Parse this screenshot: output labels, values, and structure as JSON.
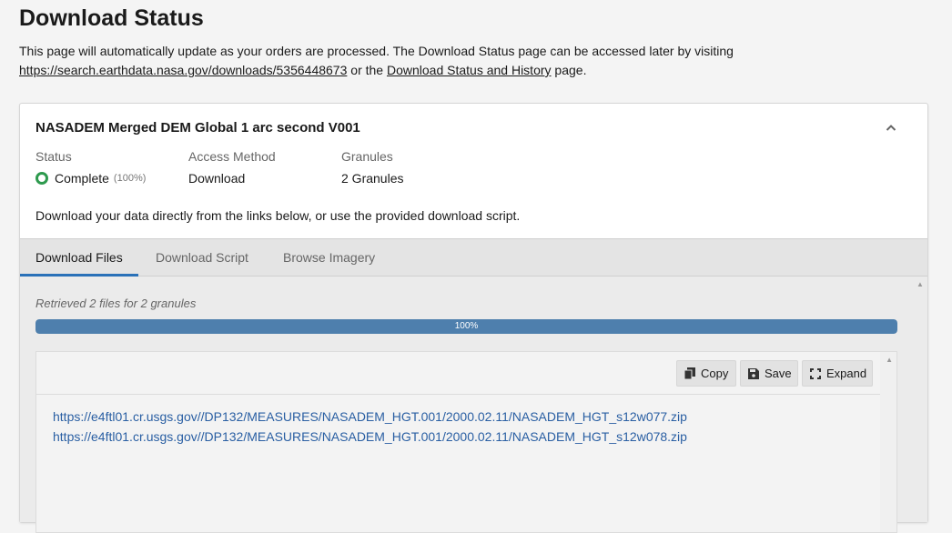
{
  "page": {
    "title": "Download Status",
    "intro_text_1": "This page will automatically update as your orders are processed. The Download Status page can be accessed later by visiting",
    "status_url": "https://search.earthdata.nasa.gov/downloads/5356448673",
    "intro_text_2": " or the ",
    "history_link": "Download Status and History",
    "intro_text_3": " page."
  },
  "order": {
    "title": "NASADEM Merged DEM Global 1 arc second V001",
    "collapse_icon": "chevron-up-icon",
    "status_label": "Status",
    "status_value": "Complete",
    "status_percent": "(100%)",
    "status_color": "#2e9a4e",
    "access_label": "Access Method",
    "access_value": "Download",
    "granules_label": "Granules",
    "granules_value": "2 Granules",
    "description": "Download your data directly from the links below, or use the provided download script."
  },
  "tabs": [
    {
      "label": "Download Files",
      "active": true
    },
    {
      "label": "Download Script",
      "active": false
    },
    {
      "label": "Browse Imagery",
      "active": false
    }
  ],
  "files_panel": {
    "retrieved_text": "Retrieved 2 files for 2 granules",
    "progress_label": "100%",
    "progress_fraction": 1.0,
    "progress_color": "#4e7fad",
    "copy_label": "Copy",
    "save_label": "Save",
    "expand_label": "Expand",
    "links": [
      "https://e4ftl01.cr.usgs.gov//DP132/MEASURES/NASADEM_HGT.001/2000.02.11/NASADEM_HGT_s12w077.zip",
      "https://e4ftl01.cr.usgs.gov//DP132/MEASURES/NASADEM_HGT.001/2000.02.11/NASADEM_HGT_s12w078.zip"
    ],
    "link_color": "#2a5fa3"
  }
}
